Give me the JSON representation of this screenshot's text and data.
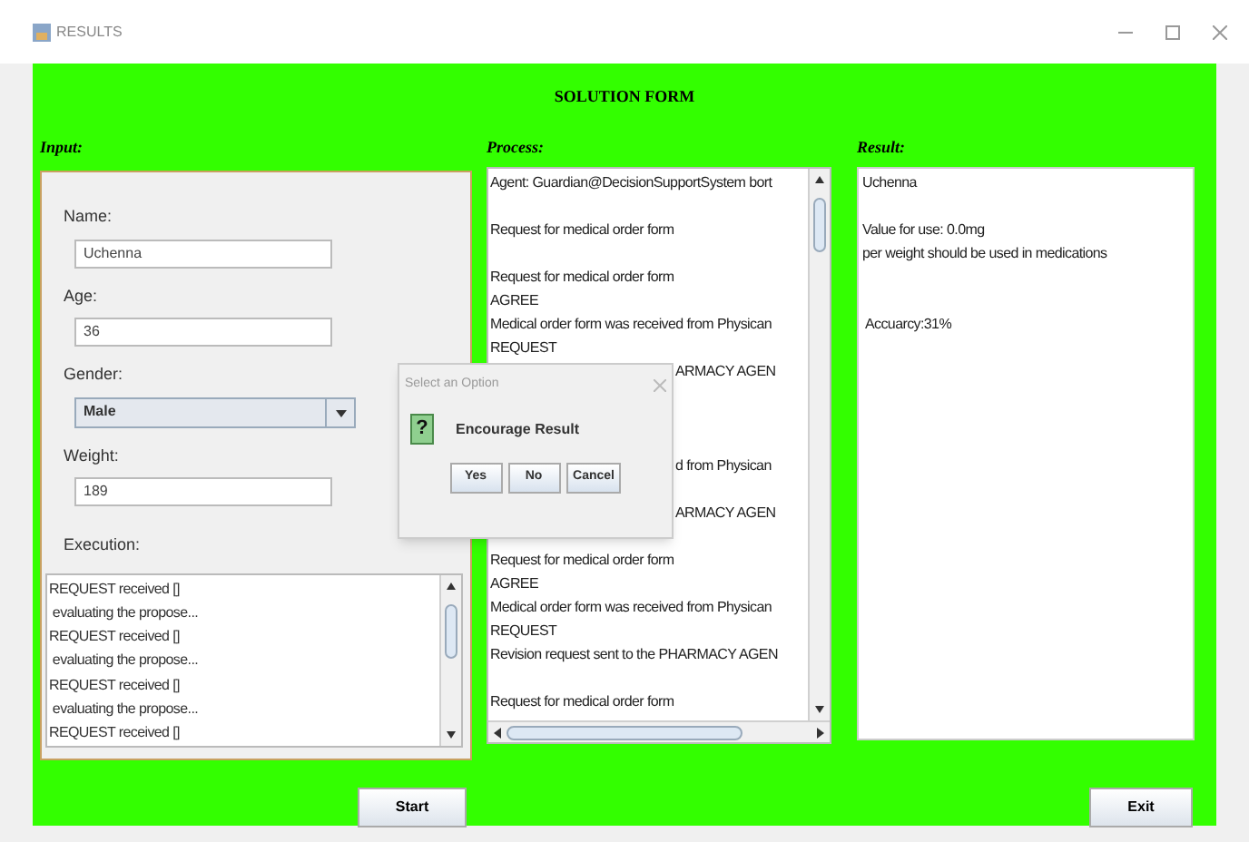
{
  "window": {
    "title": "RESULTS"
  },
  "heading": "SOLUTION FORM",
  "input": {
    "label": "Input:",
    "fields": [
      {
        "label": "Name:",
        "value": "Uchenna",
        "kind": "text"
      },
      {
        "label": "Age:",
        "value": "36",
        "kind": "text"
      },
      {
        "label": "Gender:",
        "value": "Male",
        "kind": "combo"
      },
      {
        "label": "Weight:",
        "value": "189",
        "kind": "text"
      }
    ],
    "execution": {
      "label": "Execution:",
      "lines": [
        "REQUEST received []",
        " evaluating the propose...",
        "REQUEST received []",
        " evaluating the propose...",
        "REQUEST received []",
        " evaluating the propose...",
        "REQUEST received []"
      ]
    }
  },
  "process": {
    "label": "Process:",
    "lines": [
      {
        "kind": "line",
        "text": "Agent: Guardian@DecisionSupportSystem bort"
      },
      {
        "kind": "blank"
      },
      {
        "kind": "line",
        "text": "Request for medical order form"
      },
      {
        "kind": "blank"
      },
      {
        "kind": "line",
        "text": "Request for medical order form"
      },
      {
        "kind": "line",
        "text": "AGREE"
      },
      {
        "kind": "line",
        "text": "Medical order form was received from Physican"
      },
      {
        "kind": "line",
        "text": "REQUEST"
      },
      {
        "kind": "tail",
        "text": "ARMACY AGEN"
      },
      {
        "kind": "blank"
      },
      {
        "kind": "blank"
      },
      {
        "kind": "blank"
      },
      {
        "kind": "tail",
        "text": "d from Physican"
      },
      {
        "kind": "blank"
      },
      {
        "kind": "tail",
        "text": "ARMACY AGEN"
      },
      {
        "kind": "blank"
      },
      {
        "kind": "line",
        "text": "Request for medical order form"
      },
      {
        "kind": "line",
        "text": "AGREE"
      },
      {
        "kind": "line",
        "text": "Medical order form was received from Physican"
      },
      {
        "kind": "line",
        "text": "REQUEST"
      },
      {
        "kind": "line",
        "text": "Revision request sent to the PHARMACY AGEN"
      },
      {
        "kind": "blank"
      },
      {
        "kind": "line",
        "text": "Request for medical order form"
      }
    ]
  },
  "result": {
    "label": "Result:",
    "lines": [
      {
        "kind": "line",
        "text": "Uchenna"
      },
      {
        "kind": "blank"
      },
      {
        "kind": "line",
        "text": "Value for use: 0.0mg"
      },
      {
        "kind": "line",
        "text": "per weight should be used in medications"
      },
      {
        "kind": "blank"
      },
      {
        "kind": "blank"
      },
      {
        "kind": "line",
        "text": " Accuarcy:31%"
      }
    ]
  },
  "buttons": {
    "start": "Start",
    "exit": "Exit"
  },
  "dialog": {
    "title": "Select an Option",
    "icon": "?",
    "message": "Encourage Result",
    "buttons": [
      "Yes",
      "No",
      "Cancel"
    ]
  }
}
